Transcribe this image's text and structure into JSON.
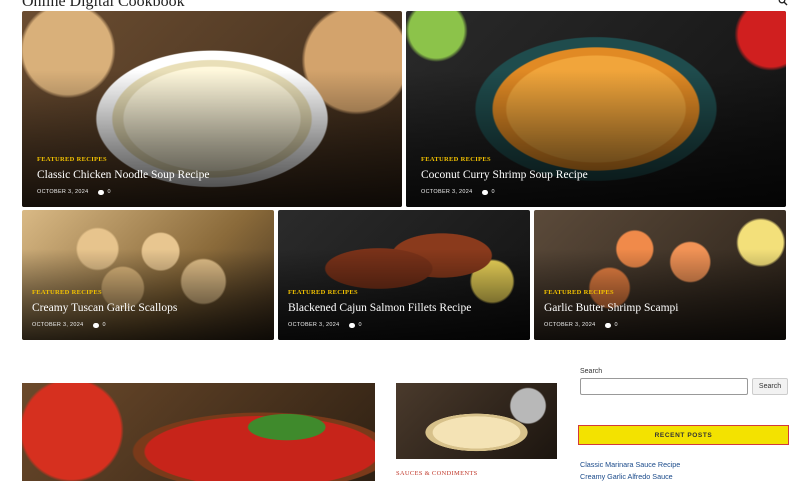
{
  "site": {
    "title": "Online Digital Cookbook"
  },
  "header": {
    "search_icon": "search-icon"
  },
  "featured": [
    {
      "category": "FEATURED RECIPES",
      "title": "Classic Chicken Noodle Soup Recipe",
      "date": "OCTOBER 3, 2024",
      "comments": "0"
    },
    {
      "category": "FEATURED RECIPES",
      "title": "Coconut Curry Shrimp Soup Recipe",
      "date": "OCTOBER 3, 2024",
      "comments": "0"
    },
    {
      "category": "FEATURED RECIPES",
      "title": "Creamy Tuscan Garlic Scallops",
      "date": "OCTOBER 3, 2024",
      "comments": "0"
    },
    {
      "category": "FEATURED RECIPES",
      "title": "Blackened Cajun Salmon Fillets Recipe",
      "date": "OCTOBER 3, 2024",
      "comments": "0"
    },
    {
      "category": "FEATURED RECIPES",
      "title": "Garlic Butter Shrimp Scampi",
      "date": "OCTOBER 3, 2024",
      "comments": "0"
    }
  ],
  "posts": [
    {
      "category": "SAUCES & CONDIMENTS"
    }
  ],
  "sidebar": {
    "search_label": "Search",
    "search_value": "",
    "search_button": "Search",
    "recent_heading": "RECENT POSTS",
    "recent_posts": [
      "Classic Marinara Sauce Recipe",
      "Creamy Garlic Alfredo Sauce"
    ]
  },
  "colors": {
    "category_accent": "#f2c200",
    "recent_bar_bg": "#f3e200",
    "recent_bar_border": "#d23a3a",
    "post_category": "#c0392b",
    "link": "#1a4a8a"
  }
}
